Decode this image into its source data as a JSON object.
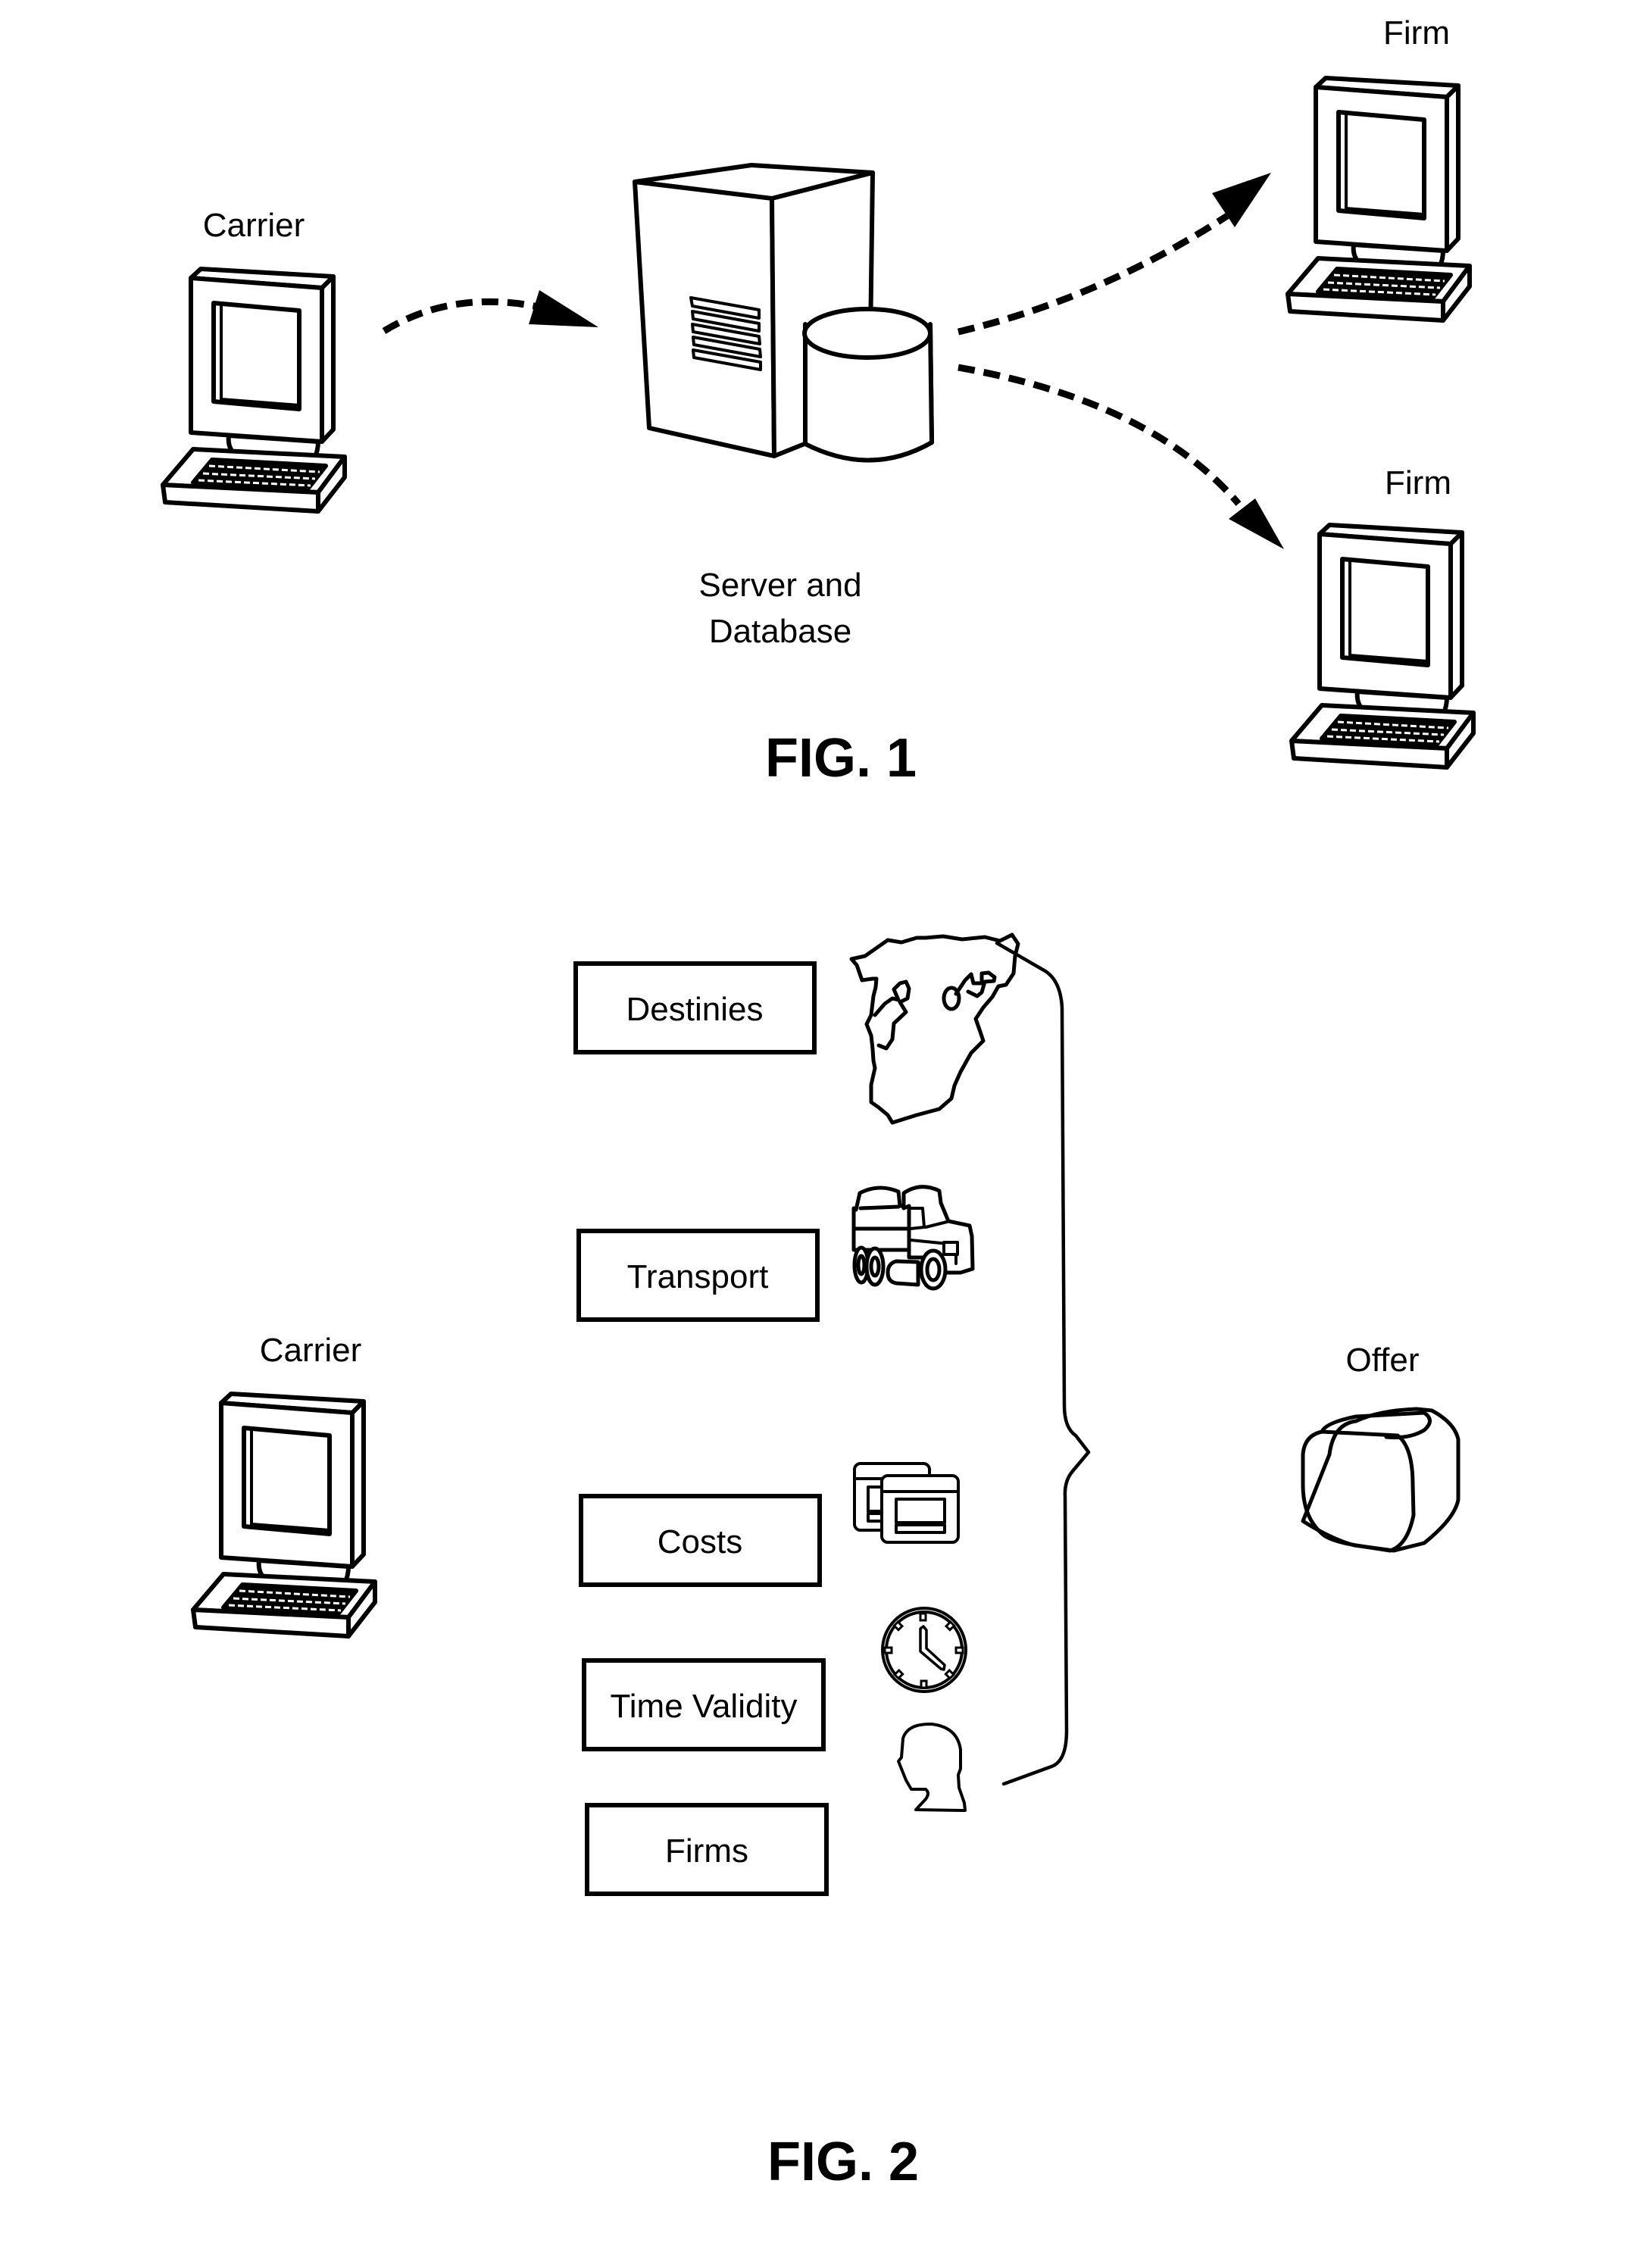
{
  "fig1": {
    "caption": "FIG. 1",
    "carrier_label": "Carrier",
    "server_label_line1": "Server and",
    "server_label_line2": "Database",
    "firm_top_label": "Firm",
    "firm_bottom_label": "Firm",
    "flows": [
      {
        "from": "Carrier",
        "to": "Server and Database",
        "style": "dashed-arrow"
      },
      {
        "from": "Server and Database",
        "to": "Firm (top)",
        "style": "dashed-arrow"
      },
      {
        "from": "Server and Database",
        "to": "Firm (bottom)",
        "style": "dashed-arrow"
      }
    ]
  },
  "fig2": {
    "caption": "FIG. 2",
    "carrier_label": "Carrier",
    "offer_label": "Offer",
    "items": [
      {
        "label": "Destinies",
        "icon": "map-icon"
      },
      {
        "label": "Transport",
        "icon": "truck-icon"
      },
      {
        "label": "Costs",
        "icon": "windows-icon"
      },
      {
        "label": "Time Validity",
        "icon": "clock-icon"
      },
      {
        "label": "Firms",
        "icon": "head-icon"
      }
    ],
    "grouping": "brace",
    "result_icon": "rounded-cube-icon"
  }
}
